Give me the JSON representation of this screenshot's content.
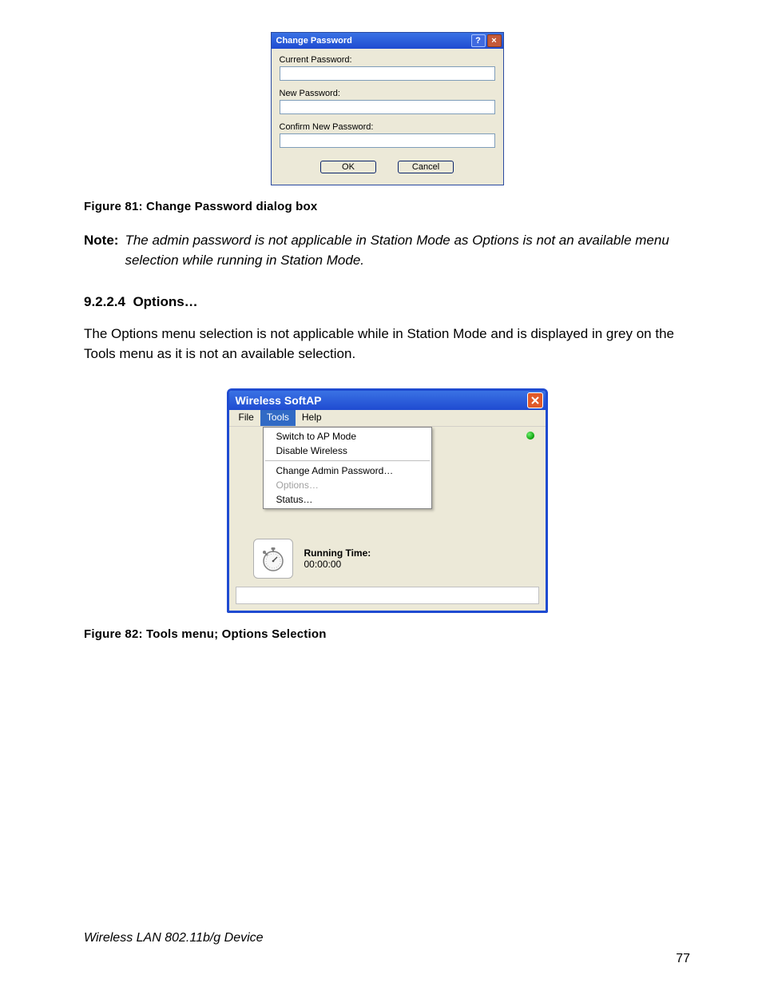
{
  "dialog81": {
    "title": "Change Password",
    "current_label": "Current Password:",
    "new_label": "New Password:",
    "confirm_label": "Confirm New Password:",
    "ok": "OK",
    "cancel": "Cancel"
  },
  "caption81": "Figure 81: Change Password dialog box",
  "note": {
    "label": "Note:",
    "text": "The admin password is not applicable in Station Mode as Options is not an available menu selection while running in Station Mode."
  },
  "section": {
    "number": "9.2.2.4",
    "title": "Options…"
  },
  "paragraph": "The Options menu selection is not applicable while in Station Mode and is displayed in grey on the Tools menu as it is not an available selection.",
  "window82": {
    "title": "Wireless SoftAP",
    "menus": {
      "file": "File",
      "tools": "Tools",
      "help": "Help"
    },
    "dropdown": {
      "switch": "Switch to AP Mode",
      "disable": "Disable Wireless",
      "change_pw": "Change Admin Password…",
      "options": "Options…",
      "status": "Status…"
    },
    "running_label": "Running Time:",
    "running_value": "00:00:00"
  },
  "caption82": "Figure 82: Tools menu; Options Selection",
  "footer": "Wireless LAN 802.11b/g Device",
  "page_number": "77"
}
